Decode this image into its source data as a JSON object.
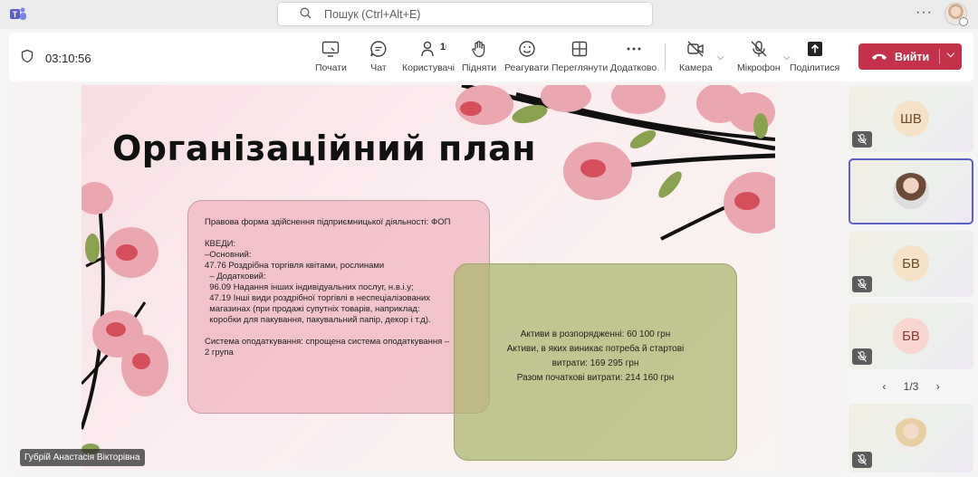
{
  "titlebar": {
    "search_placeholder": "Пошук (Ctrl+Alt+E)",
    "more_label": "···"
  },
  "meeting": {
    "timer": "03:10:56",
    "participant_count": "10",
    "leave_label": "Вийти",
    "buttons": {
      "share_screen": "Почати",
      "chat": "Чат",
      "users": "Користувачі",
      "raise_hand": "Підняти",
      "react": "Реагувати",
      "view": "Переглянути",
      "more": "Додатково",
      "camera": "Камера",
      "mic": "Мікрофон",
      "share": "Поділитися"
    },
    "colors": {
      "leave": "#c4314b",
      "accent": "#5b5fc7"
    }
  },
  "slide": {
    "title": "Організаційний план",
    "pink_box": {
      "line1": "Правова форма здійснення підприємницької діяльності: ФОП",
      "line2": "КВЕДИ:",
      "line3": "–Основний:",
      "line4": "47.76 Роздрібна торгівля квітами, рослинами",
      "line5": "  – Додатковий:",
      "line6": "  96.09 Надання інших індивідуальних послуг, н.в.і.у;",
      "line7": "  47.19 Інші види роздрібної торгівлі в неспеціалізованих",
      "line8": "  магазинах (при продажі супутніх товарів, наприклад:",
      "line9": "  коробки для пакування, пакувальний папір, декор і т.д).",
      "line10": "Система оподаткування: спрощена система оподаткування –",
      "line11": "2 група"
    },
    "green_box": {
      "line1": "Активи в розпорядженні: 60 100 грн",
      "line2": "Активи, в яких виникає потреба й стартові",
      "line3": "витрати: 169 295 грн",
      "line4": "Разом початкові витрати: 214 160 грн"
    }
  },
  "presenter_name": "Губрій Анастасія Вікторівна",
  "participants": [
    {
      "initials": "ШВ"
    },
    {
      "initials": ""
    },
    {
      "initials": "БВ"
    },
    {
      "initials": "БВ"
    },
    {
      "initials": ""
    }
  ],
  "pager": {
    "label": "1/3",
    "prev": "‹",
    "next": "›"
  }
}
